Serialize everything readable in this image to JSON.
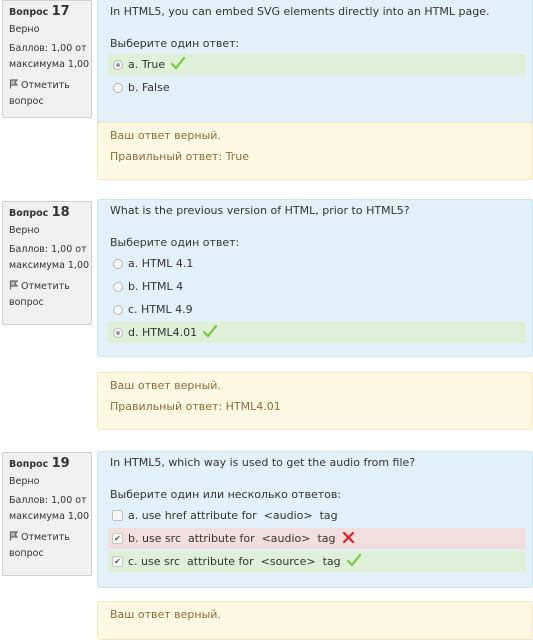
{
  "questions": [
    {
      "label": "Вопрос",
      "number": "17",
      "state": "Верно",
      "grade_line1": "Баллов: 1,00 от",
      "grade_line2": "максимума 1,00",
      "flag_line1": "Отметить",
      "flag_line2": "вопрос",
      "text": "In HTML5, you can embed SVG elements directly into an HTML page.",
      "prompt": "Выберите один ответ:",
      "input_type": "radio",
      "answers": [
        {
          "label": "a. True",
          "checked": true,
          "status": "correct"
        },
        {
          "label": "b. False",
          "checked": false,
          "status": ""
        }
      ],
      "feedback": "Ваш ответ верный.",
      "right_answer": "Правильный ответ: True"
    },
    {
      "label": "Вопрос",
      "number": "18",
      "state": "Верно",
      "grade_line1": "Баллов: 1,00 от",
      "grade_line2": "максимума 1,00",
      "flag_line1": "Отметить",
      "flag_line2": "вопрос",
      "text": "What is the previous version of HTML, prior to HTML5?",
      "prompt": "Выберите один ответ:",
      "input_type": "radio",
      "answers": [
        {
          "label": "a. HTML 4.1",
          "checked": false,
          "status": ""
        },
        {
          "label": "b. HTML 4",
          "checked": false,
          "status": ""
        },
        {
          "label": "c. HTML 4.9",
          "checked": false,
          "status": ""
        },
        {
          "label": "d. HTML4.01",
          "checked": true,
          "status": "correct"
        }
      ],
      "feedback": "Ваш ответ верный.",
      "right_answer": "Правильный ответ: HTML4.01"
    },
    {
      "label": "Вопрос",
      "number": "19",
      "state": "Верно",
      "grade_line1": "Баллов: 1,00 от",
      "grade_line2": "максимума 1,00",
      "flag_line1": "Отметить",
      "flag_line2": "вопрос",
      "text": "In HTML5, which way is used to get the audio from file?",
      "prompt": "Выберите один или несколько ответов:",
      "input_type": "checkbox",
      "answers": [
        {
          "label": "a. use href attribute for  <audio>  tag",
          "checked": false,
          "status": ""
        },
        {
          "label": "b. use src  attribute for  <audio>  tag",
          "checked": true,
          "status": "incorrect"
        },
        {
          "label": "c. use src  attribute for  <source>  tag",
          "checked": true,
          "status": "correct"
        }
      ],
      "feedback": "Ваш ответ верный.",
      "right_answer": ""
    }
  ],
  "colors": {
    "formulation_bg": "#e2f1f8",
    "outcome_bg": "#fcf8e3",
    "outcome_text": "#8a6d3b",
    "correct_bg": "#dff0d8",
    "incorrect_bg": "#f2dede",
    "check_mark": "#7cc540",
    "cross_mark": "#e02020"
  },
  "icons": {
    "flag": "flag-icon",
    "correct": "check-mark-icon",
    "incorrect": "cross-mark-icon"
  }
}
